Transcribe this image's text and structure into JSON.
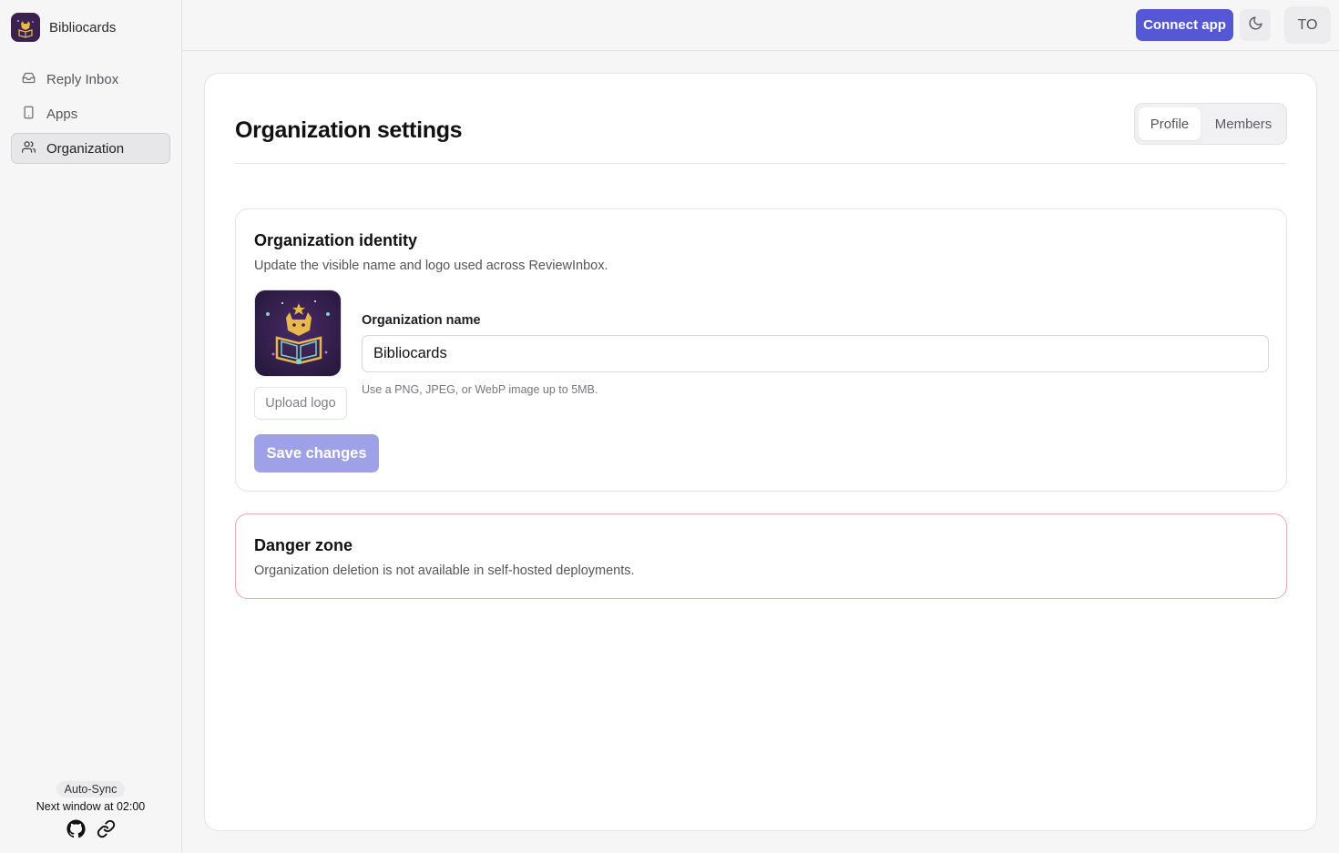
{
  "sidebar": {
    "brand": "Bibliocards",
    "items": [
      {
        "label": "Reply Inbox",
        "icon": "inbox-icon",
        "active": false
      },
      {
        "label": "Apps",
        "icon": "smartphone-icon",
        "active": false
      },
      {
        "label": "Organization",
        "icon": "users-icon",
        "active": true
      }
    ],
    "sync": {
      "badge": "Auto-Sync",
      "next": "Next window at 02:00"
    },
    "footer_icons": [
      "github-icon",
      "link-icon"
    ]
  },
  "topbar": {
    "connect_label": "Connect app",
    "theme_icon": "moon-icon",
    "avatar_initials": "TO"
  },
  "page": {
    "title": "Organization settings",
    "tabs": [
      {
        "label": "Profile",
        "active": true
      },
      {
        "label": "Members",
        "active": false
      }
    ]
  },
  "identity": {
    "title": "Organization identity",
    "description": "Update the visible name and logo used across ReviewInbox.",
    "upload_label": "Upload logo",
    "name_label": "Organization name",
    "name_value": "Bibliocards",
    "hint": "Use a PNG, JPEG, or WebP image up to 5MB.",
    "save_label": "Save changes"
  },
  "danger": {
    "title": "Danger zone",
    "description": "Organization deletion is not available in self-hosted deployments."
  },
  "colors": {
    "accent": "#5458d5",
    "accent_disabled": "#9ea1e8",
    "danger_border": "#f2a7ad"
  }
}
